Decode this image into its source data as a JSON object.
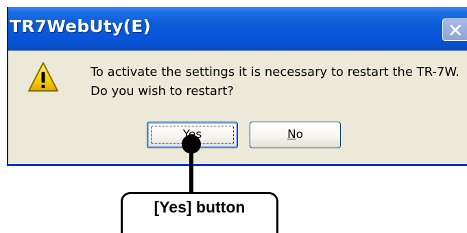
{
  "window": {
    "title": "TR7WebUty(E)",
    "close_icon": "close-icon"
  },
  "dialog": {
    "icon": "warning-icon",
    "message_line1": "To activate the settings it is necessary to restart the TR-7W.",
    "message_line2": "Do you wish to restart?",
    "buttons": {
      "yes": {
        "mnemonic": "Y",
        "rest": "es"
      },
      "no": {
        "mnemonic": "N",
        "rest": "o"
      }
    }
  },
  "callout": {
    "label": "[Yes] button"
  },
  "colors": {
    "titlebar": "#0855dd",
    "dialog_bg": "#ece9d8",
    "button_border": "#003c74"
  }
}
